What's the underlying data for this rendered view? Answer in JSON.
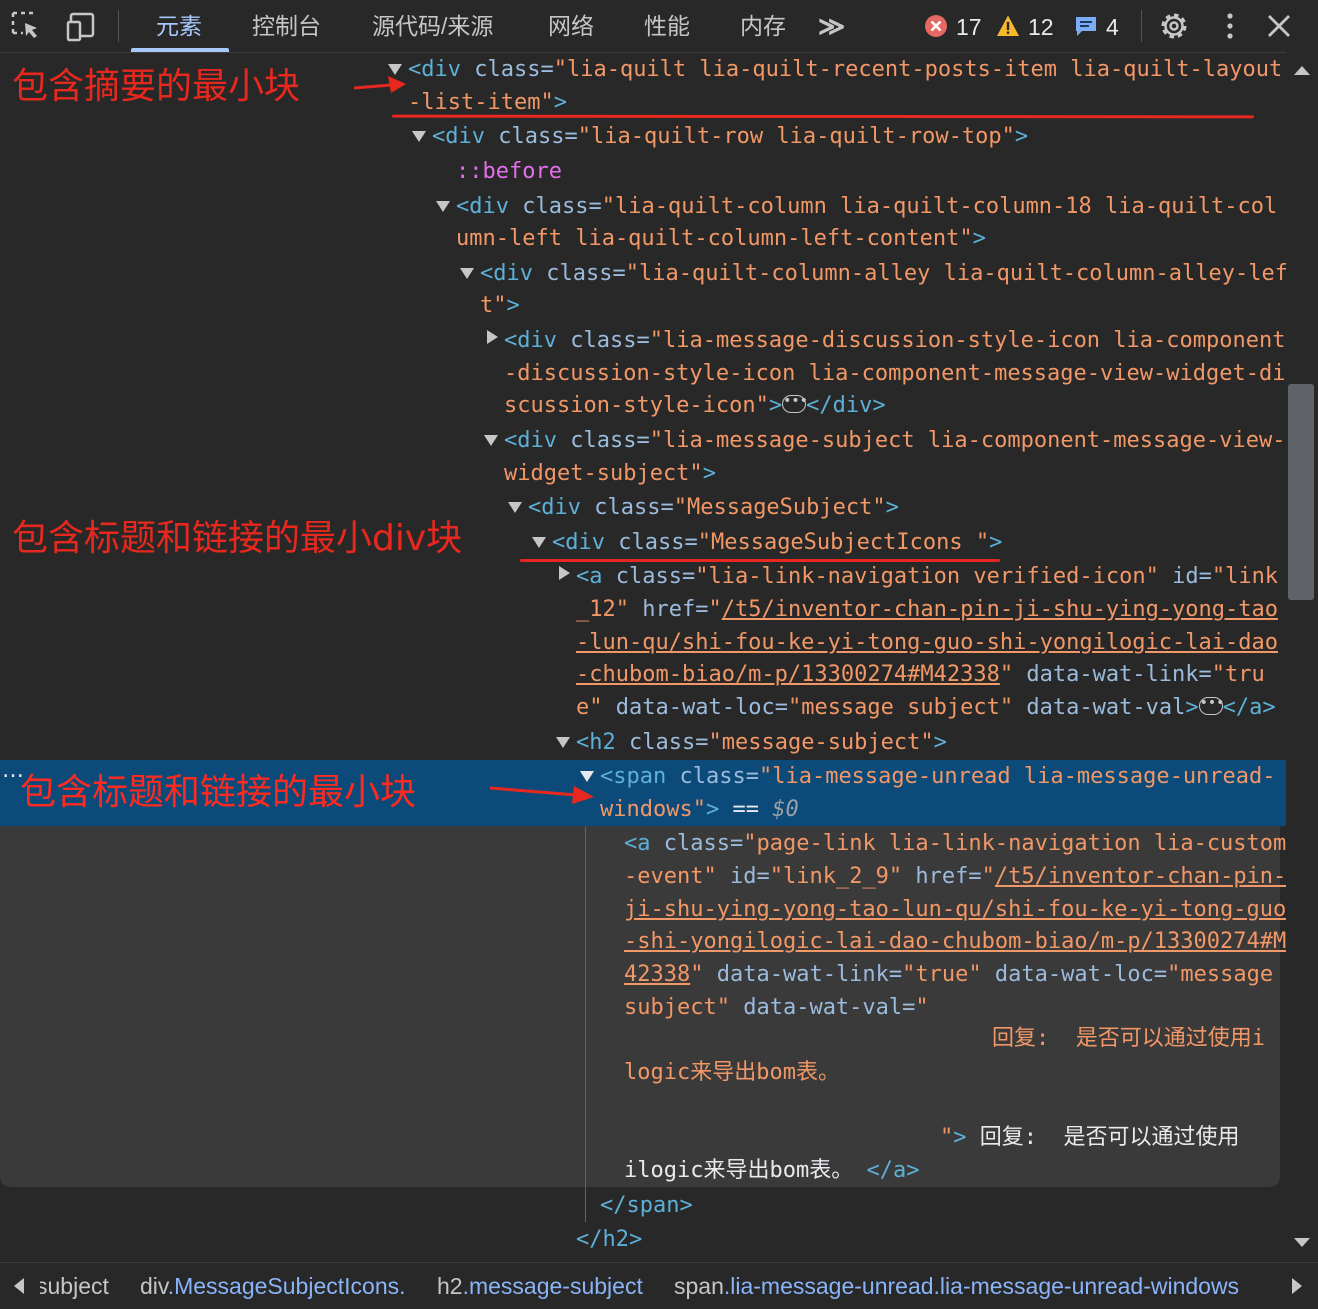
{
  "toolbar": {
    "tabs": [
      "元素",
      "控制台",
      "源代码/来源",
      "网络",
      "性能",
      "内存"
    ],
    "more": "≫",
    "errors": "17",
    "warnings": "12",
    "messages": "4"
  },
  "tree": {
    "r1a_tag": "<div",
    "r1a_attr": "class",
    "r1a_val": "\"lia-quilt lia-quilt-recent-posts-item lia-quilt-layout",
    "r1b_val": "-list-item\"",
    "r1b_close": ">",
    "r2_tag": "<div",
    "r2_attr": "class",
    "r2_val": "\"lia-quilt-row lia-quilt-row-top\"",
    "r2_close": ">",
    "r3": "::before",
    "r4a_tag": "<div",
    "r4a_attr": "class",
    "r4a_val": "\"lia-quilt-column lia-quilt-column-18 lia-quilt-col",
    "r4b_val": "umn-left lia-quilt-column-left-content\"",
    "r4b_close": ">",
    "r5a_tag": "<div",
    "r5a_attr": "class",
    "r5a_val": "\"lia-quilt-column-alley lia-quilt-column-alley-lef",
    "r5b_val": "t\"",
    "r5b_close": ">",
    "r6a_tag": "<div",
    "r6a_attr": "class",
    "r6a_val": "\"lia-message-discussion-style-icon lia-component",
    "r6b_val": "-discussion-style-icon lia-component-message-view-widget-di",
    "r6c_val": "scussion-style-icon\"",
    "r6c_mid": ">",
    "r6c_end": "</div>",
    "r7a_tag": "<div",
    "r7a_attr": "class",
    "r7a_val": "\"lia-message-subject lia-component-message-view-",
    "r7b_val": "widget-subject\"",
    "r7b_close": ">",
    "r8_tag": "<div",
    "r8_attr": "class",
    "r8_val": "\"MessageSubject\"",
    "r8_close": ">",
    "r9_tag": "<div",
    "r9_attr": "class",
    "r9_val": "\"MessageSubjectIcons \"",
    "r9_close": ">",
    "r10a_tag": "<a",
    "r10a_attr": "class",
    "r10a_val": "\"lia-link-navigation verified-icon\"",
    "r10a_attr2": "id",
    "r10a_val2": "\"link",
    "r10b_val": "_12\"",
    "r10b_attr": "href",
    "r10b_q": "\"",
    "r10b_link": "/t5/inventor-chan-pin-ji-shu-ying-yong-tao",
    "r10c_link": "-lun-qu/shi-fou-ke-yi-tong-guo-shi-yongilogic-lai-dao",
    "r10d_link": "-chubom-biao/m-p/13300274#M42338",
    "r10d_q": "\"",
    "r10d_attr": "data-wat-link",
    "r10d_val": "\"tru",
    "r10e_val": "e\"",
    "r10e_attr": "data-wat-loc",
    "r10e_val2": "\"message subject\"",
    "r10e_attr2": "data-wat-val",
    "r10e_mid": ">",
    "r10e_end": "</a>",
    "r11_tag": "<h2",
    "r11_attr": "class",
    "r11_val": "\"message-subject\"",
    "r11_close": ">",
    "r12a_tag": "<span",
    "r12a_attr": "class",
    "r12a_val": "\"lia-message-unread lia-message-unread-",
    "r12b_val": "windows\"",
    "r12b_close": ">",
    "r12b_eq": " == ",
    "r12b_var": "$0",
    "r13a_tag": "<a",
    "r13a_attr": "class",
    "r13a_val": "\"page-link lia-link-navigation lia-custom",
    "r13b_val": "-event\"",
    "r13b_attr": "id",
    "r13b_val2": "\"link_2_9\"",
    "r13b_attr2": "href",
    "r13b_q": "\"",
    "r13b_link": "/t5/inventor-chan-pin-",
    "r13c_link": "ji-shu-ying-yong-tao-lun-qu/shi-fou-ke-yi-tong-guo",
    "r13d_link": "-shi-yongilogic-lai-dao-chubom-biao/m-p/13300274#M",
    "r13e_link": "42338",
    "r13e_q": "\"",
    "r13e_attr": "data-wat-link",
    "r13e_val": "\"true\"",
    "r13e_attr2": "data-wat-loc",
    "r13e_val2": "\"message",
    "r13f_val": "subject\"",
    "r13f_attr": "data-wat-val",
    "r13f_val2": "\"",
    "r13g_val": "回复:  是否可以通过使用i",
    "r13h_val": "logic来导出bom表。",
    "r13i_val": "\"",
    "r13i_close": ">",
    "r13i_text": " 回复:  是否可以通过使用",
    "r13j_text": "ilogic来导出bom表。",
    "r13j_end": "</a>",
    "r14": "</span>",
    "r15": "</h2>"
  },
  "annotations": {
    "a1": "包含摘要的最小块",
    "a2": "包含标题和链接的最小div块",
    "a3": "包含标题和链接的最小块"
  },
  "breadcrumbs": {
    "c1": "subject",
    "c2_pre": "div",
    "c2": ".MessageSubjectIcons.",
    "c3_pre": "h2",
    "c3": ".message-subject",
    "c4_pre": "span",
    "c4": ".lia-message-unread.lia-message-unread-windows"
  },
  "colors": {
    "annotation": "#e8281e",
    "selection": "#0c4a7a",
    "tag": "#5db0d7",
    "attr_value": "#f29766"
  }
}
